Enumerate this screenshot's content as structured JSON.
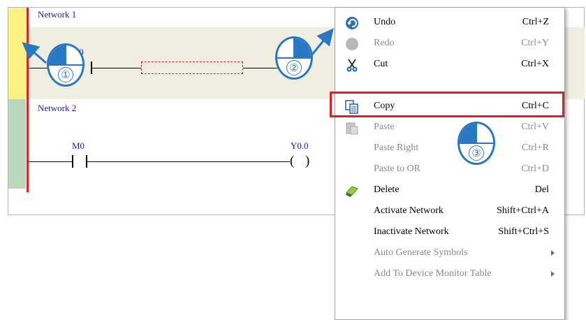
{
  "editor": {
    "network1": {
      "title": "Network 1",
      "contact_label": "X0.0"
    },
    "network2": {
      "title": "Network 2",
      "contact_label": "M0",
      "coil_label": "Y0.0"
    }
  },
  "markers": [
    "①",
    "②",
    "③"
  ],
  "context_menu": {
    "items": [
      {
        "label": "Undo",
        "shortcut": "Ctrl+Z",
        "icon": "undo-icon",
        "enabled": true
      },
      {
        "label": "Redo",
        "shortcut": "Ctrl+Y",
        "icon": "redo-icon",
        "enabled": false
      },
      {
        "label": "Cut",
        "shortcut": "Ctrl+X",
        "icon": "scissors-icon",
        "enabled": true
      },
      {
        "label": "Copy",
        "shortcut": "Ctrl+C",
        "icon": "copy-icon",
        "enabled": true,
        "highlighted": true
      },
      {
        "label": "Paste",
        "shortcut": "Ctrl+V",
        "icon": "paste-icon",
        "enabled": false
      },
      {
        "label": "Paste Right",
        "shortcut": "Ctrl+R",
        "enabled": false
      },
      {
        "label": "Paste to OR",
        "shortcut": "Ctrl+D",
        "enabled": false
      },
      {
        "label": "Delete",
        "shortcut": "Del",
        "icon": "eraser-icon",
        "enabled": true
      },
      {
        "label": "Activate Network",
        "shortcut": "Shift+Ctrl+A",
        "enabled": true
      },
      {
        "label": "Inactivate Network",
        "shortcut": "Shift+Ctrl+S",
        "enabled": true
      },
      {
        "label": "Auto Generate Symbols",
        "submenu": true,
        "enabled": false
      },
      {
        "label": "Add To Device Monitor Table",
        "submenu": true,
        "enabled": false
      }
    ]
  },
  "colors": {
    "highlight": "#e11d23",
    "marker_blue": "#2b78c2",
    "rail": "#e51f1f"
  }
}
